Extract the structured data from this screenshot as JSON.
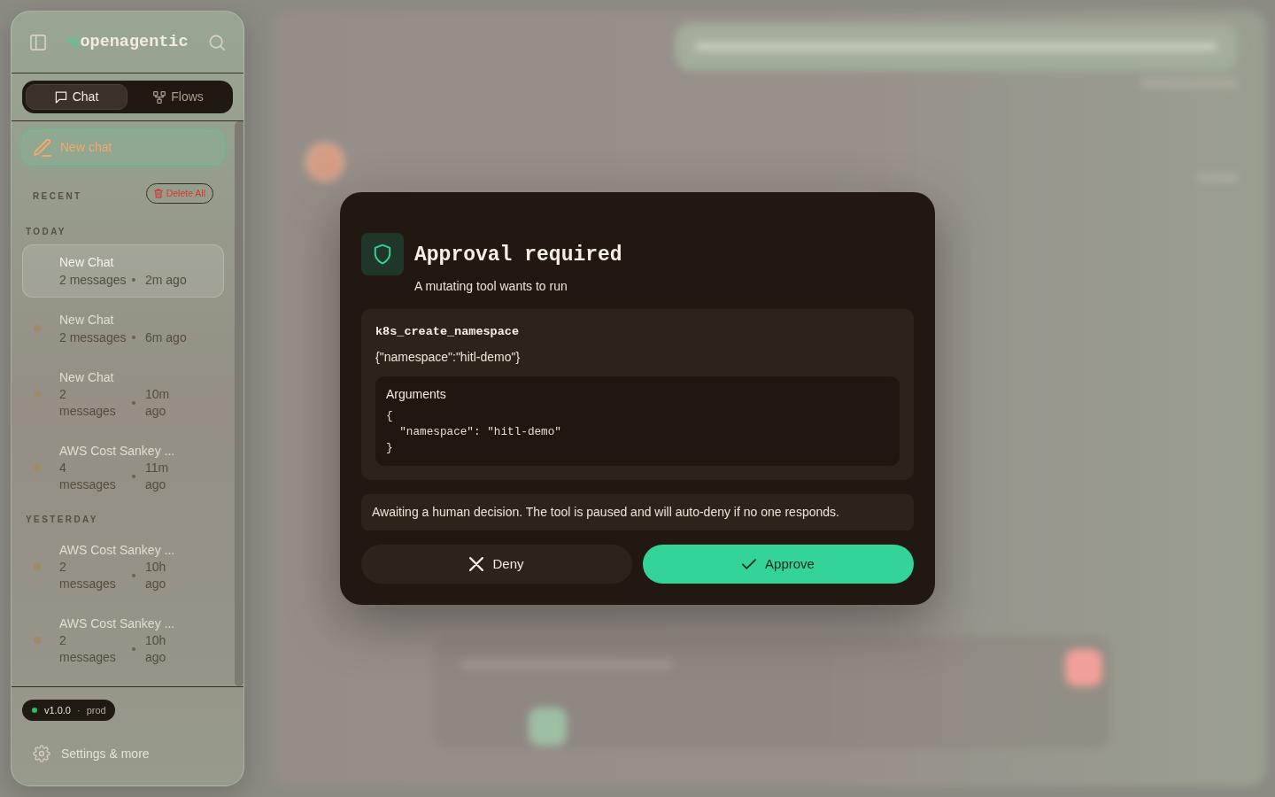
{
  "sidebar": {
    "logo": "openagentic",
    "tabs": [
      {
        "label": "Chat",
        "selected": true
      },
      {
        "label": "Flows",
        "selected": false
      }
    ],
    "new_chat_button": "New chat",
    "section_label": "RECENT",
    "delete_all_button": "Delete All",
    "groups": [
      {
        "label": "TODAY",
        "chats": [
          {
            "title": "New Chat",
            "messages": "2 messages",
            "age": "2m ago",
            "selected": true,
            "kind": "inline"
          },
          {
            "title": "New Chat",
            "messages": "2 messages",
            "age": "6m ago",
            "selected": false,
            "kind": "inline"
          },
          {
            "title": "New Chat",
            "messages": "2 messages",
            "age": "10m ago",
            "selected": false,
            "kind": "stacked"
          },
          {
            "title": "AWS Cost Sankey ...",
            "messages": "4 messages",
            "age": "11m ago",
            "selected": false,
            "kind": "stacked"
          }
        ]
      },
      {
        "label": "YESTERDAY",
        "chats": [
          {
            "title": "AWS Cost Sankey ...",
            "messages": "2 messages",
            "age": "10h ago",
            "selected": false,
            "kind": "stacked"
          },
          {
            "title": "AWS Cost Sankey ...",
            "messages": "2 messages",
            "age": "10h ago",
            "selected": false,
            "kind": "stacked"
          }
        ]
      }
    ],
    "version_badge": {
      "version": "v1.0.0",
      "separator": "·",
      "environment": "prod"
    },
    "settings_link": "Settings & more"
  },
  "approval_dialog": {
    "title": "Approval required",
    "subtitle": "A mutating tool wants to run",
    "tool_name": "k8s_create_namespace",
    "tool_input": "{\"namespace\":\"hitl-demo\"}",
    "arguments_label": "Arguments",
    "arguments_code": "{\n  \"namespace\": \"hitl-demo\"\n}",
    "notice": "Awaiting a human decision. The tool is paused and will auto-deny if no one responds.",
    "buttons": [
      {
        "label": "Deny",
        "kind": "deny"
      },
      {
        "label": "Approve",
        "kind": "approve"
      }
    ]
  }
}
